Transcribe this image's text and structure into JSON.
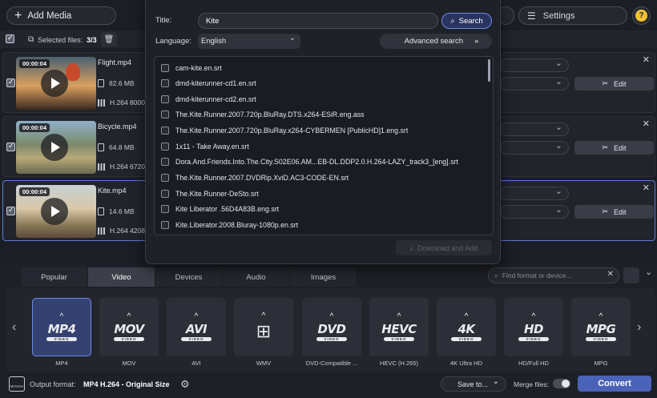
{
  "toolbar": {
    "add_media_label": "Add Media",
    "settings_label": "Settings",
    "help_label": "?"
  },
  "selection": {
    "label": "Selected files:",
    "count": "3/3"
  },
  "files": [
    {
      "duration": "00:00:04",
      "name": "Flight.mp4",
      "size": "82.6 MB",
      "codec": "H.264 8000"
    },
    {
      "duration": "00:00:04",
      "name": "Bicycle.mp4",
      "size": "64.8 MB",
      "codec": "H.264 6720"
    },
    {
      "duration": "00:00:04",
      "name": "Kite.mp4",
      "size": "14.6 MB",
      "codec": "H.264 4208"
    }
  ],
  "edit_label": "Edit",
  "subtitle_search": {
    "title_label": "Title:",
    "title_value": "Kite",
    "search_label": "Search",
    "language_label": "Language:",
    "language_value": "English",
    "advanced_label": "Advanced search",
    "results": [
      "cam-kite.en.srt",
      "dmd-kiterunner-cd1.en.srt",
      "dmd-kiterunner-cd2.en.srt",
      "The.Kite.Runner.2007.720p.BluRay.DTS.x264-ESiR.eng.ass",
      "The.Kite.Runner.2007.720p.BluRay.x264-CYBERMEN [PublicHD]1.eng.srt",
      "1x11 - Take Away.en.srt",
      "Dora.And.Friends.Into.The.City.S02E06.AM...EB-DL.DDP2.0.H.264-LAZY_track3_[eng].srt",
      "The.Kite.Runner.2007.DVDRip.XviD.AC3-CODE-EN.srt",
      "The.Kite.Runner-DeSto.srt",
      "Kite Liberator .56D4A83B.eng.srt",
      "Kite.Liberator.2008.Bluray-1080p.en.srt"
    ],
    "download_label": "Download and Add"
  },
  "format_tabs": [
    "Popular",
    "Video",
    "Devices",
    "Audio",
    "Images"
  ],
  "selected_tab": "Video",
  "format_search_placeholder": "Find format or device...",
  "formats": [
    {
      "logo": "MP4",
      "label": "MP4"
    },
    {
      "logo": "MOV",
      "label": "MOV"
    },
    {
      "logo": "AVI",
      "label": "AVI"
    },
    {
      "logo": "WMV",
      "label": "WMV"
    },
    {
      "logo": "DVD",
      "label": "DVD-Compatible ..."
    },
    {
      "logo": "HEVC",
      "label": "HEVC (H.265)"
    },
    {
      "logo": "4K",
      "label": "4K Ultra HD"
    },
    {
      "logo": "HD",
      "label": "HD/Full HD"
    },
    {
      "logo": "MPG",
      "label": "MPG"
    }
  ],
  "video_badge": "VIDEO",
  "bottom": {
    "output_icon_text": "MOVAVI",
    "output_label": "Output format:",
    "output_value": "MP4 H.264 - Original Size",
    "save_to_label": "Save to...",
    "merge_label": "Merge files:",
    "convert_label": "Convert"
  },
  "colors": {
    "accent": "#4a63b8",
    "background": "#1c1e25",
    "selected_border": "#6e8ae6"
  }
}
